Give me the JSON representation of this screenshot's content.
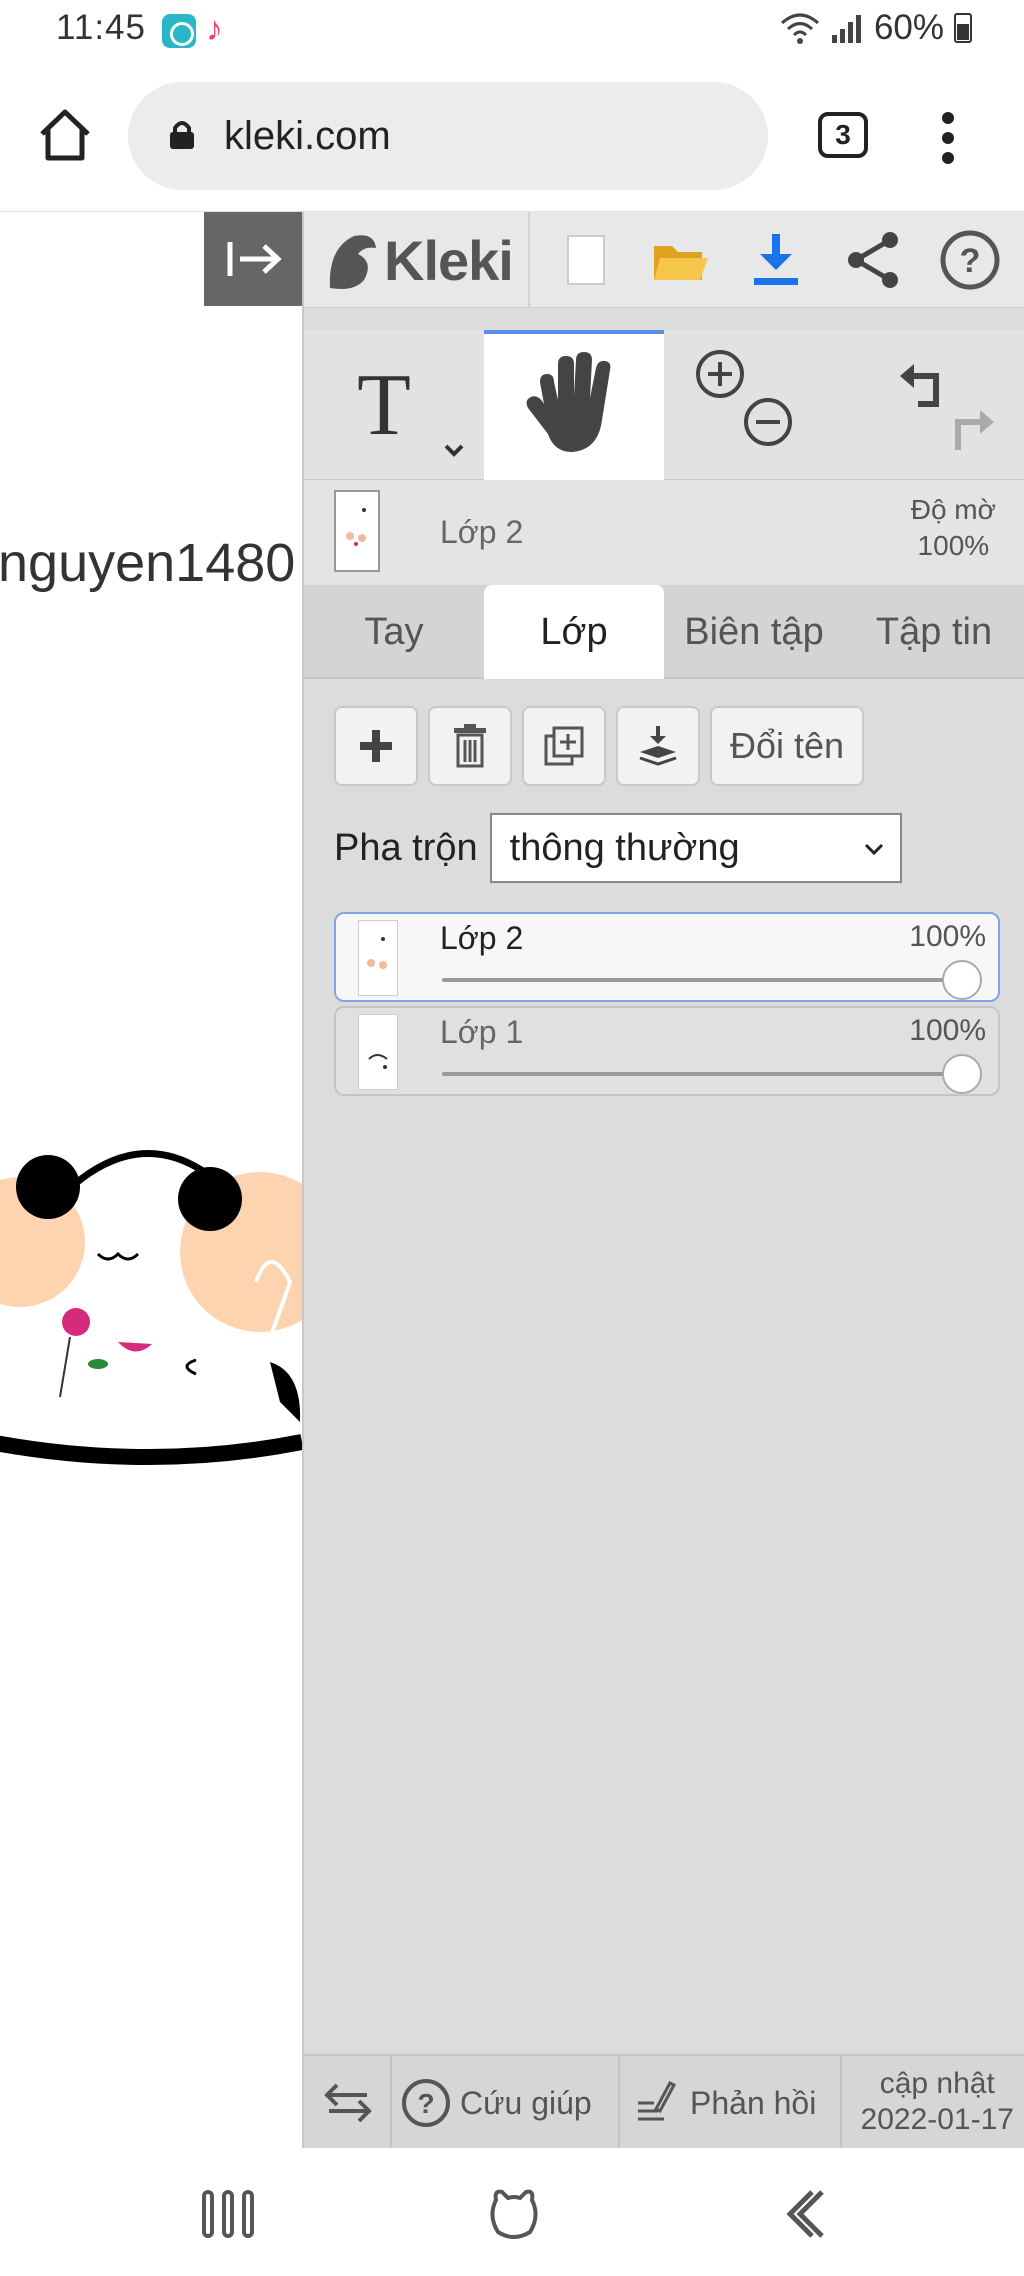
{
  "status_bar": {
    "time": "11:45",
    "battery": "60%"
  },
  "browser": {
    "url": "kleki.com",
    "tab_count": "3"
  },
  "canvas": {
    "text": "nguyen1480"
  },
  "app": {
    "logo": "Kleki",
    "layer_info": {
      "name": "Lớp 2",
      "opacity_label": "Độ mờ",
      "opacity_value": "100%"
    },
    "tabs": [
      "Tay",
      "Lớp",
      "Biên tập",
      "Tập tin"
    ],
    "active_tab": "Lớp",
    "actions": {
      "rename": "Đổi tên"
    },
    "blend": {
      "label": "Pha trộn",
      "value": "thông thường"
    },
    "layers": [
      {
        "name": "Lớp 2",
        "opacity": "100%",
        "selected": true
      },
      {
        "name": "Lớp 1",
        "opacity": "100%",
        "selected": false
      }
    ],
    "footer": {
      "help": "Cứu giúp",
      "feedback": "Phản hồi",
      "update_label": "cập nhật",
      "update_date": "2022-01-17"
    }
  },
  "icons": {
    "home": "home-icon",
    "lock": "lock-icon",
    "menu": "more-vert-icon",
    "collapse": "collapse-panel-icon",
    "new": "new-file-icon",
    "open": "folder-icon",
    "save": "download-icon",
    "share": "share-icon",
    "help": "help-icon",
    "text_tool": "text-tool-icon",
    "hand_tool": "hand-icon",
    "zoom_in": "zoom-in-icon",
    "zoom_out": "zoom-out-icon",
    "undo": "undo-icon",
    "redo": "redo-icon"
  },
  "colors": {
    "accent": "#5b8ee6",
    "panel_bg": "#dcdcdc",
    "folder": "#f5b82e",
    "download": "#1a73e8"
  }
}
